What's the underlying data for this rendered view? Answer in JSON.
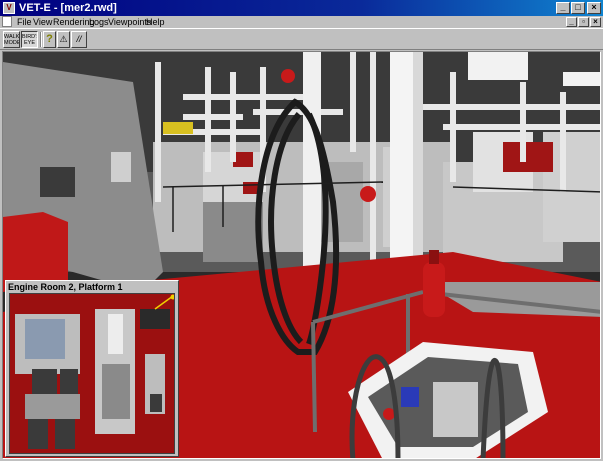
{
  "window": {
    "title": "VET-E - [mer2.rwd]",
    "app_icon_glyph": "V",
    "controls": {
      "minimize": "_",
      "maximize": "□",
      "close": "×"
    },
    "mdi_controls": {
      "minimize": "_",
      "restore": "▫",
      "close": "×"
    }
  },
  "menubar": {
    "items": [
      "File",
      "View",
      "Rendering",
      "Logs",
      "Viewpoints",
      "Help"
    ]
  },
  "toolbar": {
    "walk_label": "WALK\nMODE",
    "bird_label": "BIRD'S\nEYE",
    "help_glyph": "?",
    "tool1_glyph": "⚠",
    "tool2_glyph": "//"
  },
  "minimap": {
    "title": "Engine Room 2, Platform 1"
  },
  "colors": {
    "title_bar": "#000080",
    "deck_red": "#b81414",
    "machinery_white": "#e6e6e6",
    "chrome": "#c0c0c0"
  }
}
